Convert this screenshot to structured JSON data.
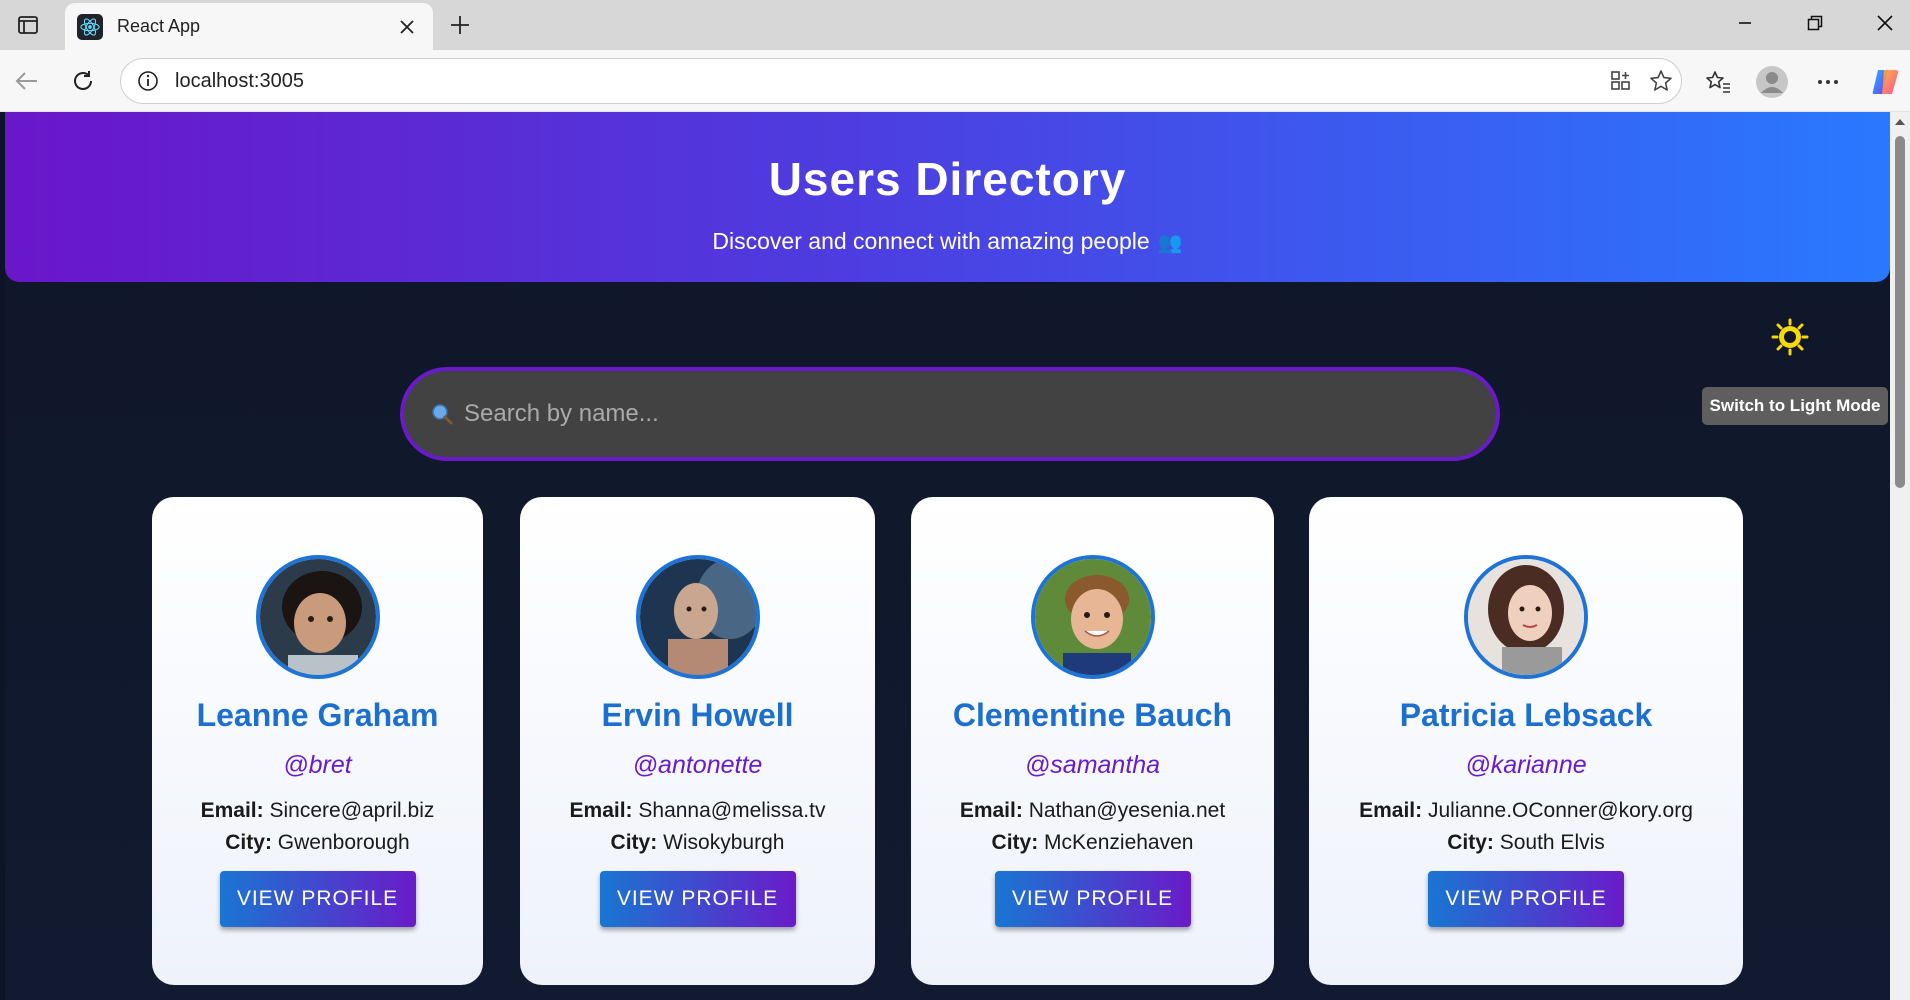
{
  "browser": {
    "tab_title": "React App",
    "url": "localhost:3005"
  },
  "hero": {
    "title": "Users Directory",
    "subtitle": "Discover and connect with amazing people",
    "emoji": "👥"
  },
  "theme_toggle": {
    "tooltip": "Switch to Light Mode",
    "icon": "sun-icon"
  },
  "search": {
    "placeholder": "Search by name...",
    "value": ""
  },
  "labels": {
    "email": "Email:",
    "city": "City:",
    "view_profile": "VIEW PROFILE"
  },
  "users": [
    {
      "name": "Leanne Graham",
      "username": "@bret",
      "email": "Sincere@april.biz",
      "city": "Gwenborough"
    },
    {
      "name": "Ervin Howell",
      "username": "@antonette",
      "email": "Shanna@melissa.tv",
      "city": "Wisokyburgh"
    },
    {
      "name": "Clementine Bauch",
      "username": "@samantha",
      "email": "Nathan@yesenia.net",
      "city": "McKenziehaven"
    },
    {
      "name": "Patricia Lebsack",
      "username": "@karianne",
      "email": "Julianne.OConner@kory.org",
      "city": "South Elvis"
    }
  ],
  "colors": {
    "hero_start": "#6a16c9",
    "hero_end": "#2979ff",
    "name_blue": "#1c6fcf",
    "username_purple": "#6a1bc9",
    "page_bg": "#0f1628",
    "sun_yellow": "#f5d90a"
  }
}
